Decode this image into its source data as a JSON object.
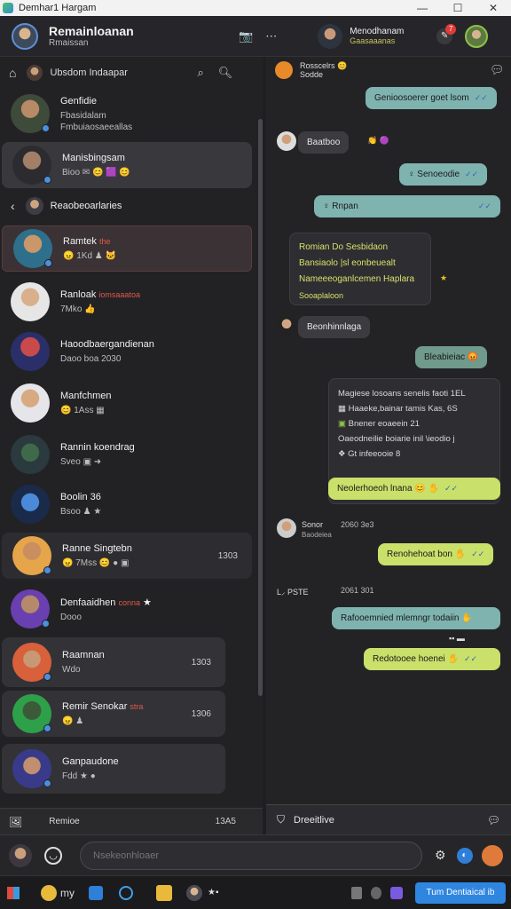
{
  "window": {
    "title": "Demhar1 Hargam",
    "minimize": "—",
    "maximize": "☐",
    "close": "✕"
  },
  "header": {
    "user_name": "Remainloanan",
    "user_sub": "Rmaissan",
    "contact_name": "Menodhanam",
    "contact_sub": "Gaasaaanas",
    "notif_count": "7"
  },
  "sidebar": {
    "top_label": "Ubsdom Indaapar",
    "section_label": "Reaobeoarlaries",
    "conversations": [
      {
        "name": "Genfidie",
        "flag": "",
        "last": "Fbasidalam",
        "last2": "Fmbuiaosaeeallas",
        "time": ""
      },
      {
        "name": "Manisbingsam",
        "flag": "",
        "last": "Bioo",
        "time": ""
      },
      {
        "name": "Ramtek",
        "flag": "the",
        "last": "1Kd",
        "time": ""
      },
      {
        "name": "Ranloak",
        "flag": "iomsaaatoa",
        "last": "7Mko",
        "time": ""
      },
      {
        "name": "Haoodbaergandienan",
        "flag": "",
        "last": "Daoo boa 2030",
        "time": ""
      },
      {
        "name": "Manfchmen",
        "flag": "",
        "last": "1Ass",
        "time": ""
      },
      {
        "name": "Rannin koendrag",
        "flag": "",
        "last": "Sveo",
        "time": ""
      },
      {
        "name": "Boolin 36",
        "flag": "",
        "last": "Bsoo",
        "time": ""
      },
      {
        "name": "Ranne Singtebn",
        "flag": "",
        "last": "7Mss",
        "time": "1303"
      },
      {
        "name": "Denfaaidhen",
        "flag": "conna",
        "last": "Dooo",
        "time": ""
      },
      {
        "name": "Raamnan",
        "flag": "",
        "last": "Wdo",
        "time": "1303"
      },
      {
        "name": "Remir Senokar",
        "flag": "stra",
        "last": "",
        "time": "1306"
      },
      {
        "name": "Ganpaudone",
        "flag": "",
        "last": "Fdd",
        "time": ""
      }
    ],
    "bottom_label": "Remioe",
    "bottom_time": "13A5"
  },
  "chat": {
    "top_line1": "Rosscelrs",
    "top_line2": "Sodde",
    "messages": [
      {
        "text": "Genioosoerer goet lsom"
      },
      {
        "text": "Baatboo"
      },
      {
        "text": "Senoeodie"
      },
      {
        "text": "Rnpan"
      },
      {
        "text": "Romian Do Sesbidaon"
      },
      {
        "text": "Bansiaolo |sl eonbeuealt"
      },
      {
        "text": "Nameeeoganlcemen Haplara"
      },
      {
        "text": "Sooaplaloon"
      },
      {
        "text": "Beonhinnlaga"
      },
      {
        "text": "Bleabieiac"
      },
      {
        "text": "Magiese losoans senelis faoti 1EL"
      },
      {
        "text": "Haaeke,bainar tamis Kas, 6S"
      },
      {
        "text": "Bnener eoaeein 21"
      },
      {
        "text": "Oaeodneilie boiarie inil \\ieodio j"
      },
      {
        "text": "Gt infeeooie 8"
      },
      {
        "text": "Neolerhoeoh lnana"
      },
      {
        "text": "Sonor"
      },
      {
        "text": "Baodeiea"
      },
      {
        "text": "Renohehoat bon"
      },
      {
        "text": "PSTE"
      },
      {
        "text": "Rafooemnied mlemngr todaiin"
      },
      {
        "text": "Redotooee hoenei"
      }
    ],
    "times": [
      "2060 3e3",
      "2061 301"
    ],
    "compose_label": "Dreeitlive"
  },
  "input": {
    "placeholder": "Nsekeonhloaer"
  },
  "taskbar": {
    "label": "my",
    "button": "Tum Dentiaical ib"
  },
  "colors": {
    "teal": "#7fb3b0",
    "lime": "#c9e06a",
    "accent": "#2f86e0"
  }
}
